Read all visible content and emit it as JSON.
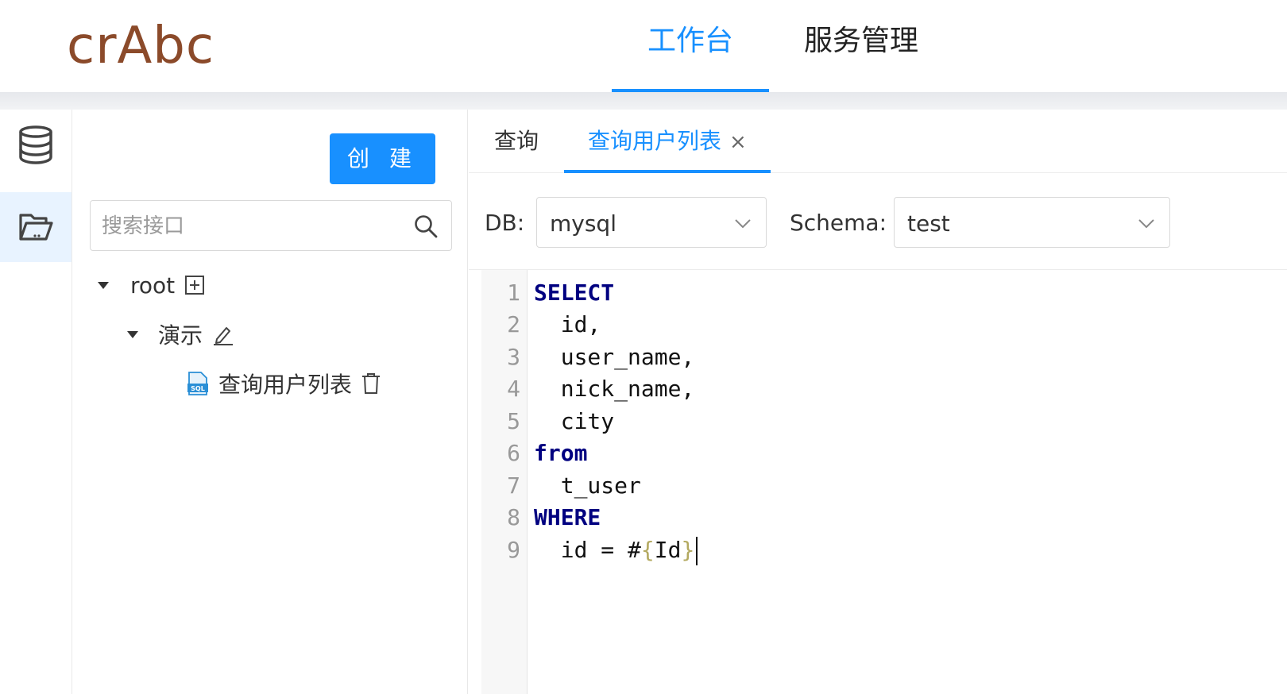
{
  "header": {
    "logo": "crAbc",
    "nav": [
      {
        "label": "工作台",
        "active": true
      },
      {
        "label": "服务管理",
        "active": false
      }
    ]
  },
  "rail": {
    "items": [
      {
        "icon": "database-icon",
        "active": false
      },
      {
        "icon": "folder-open-icon",
        "active": true
      }
    ]
  },
  "sidebar": {
    "create_label": "创 建",
    "search": {
      "placeholder": "搜索接口",
      "value": ""
    },
    "tree": {
      "root": {
        "label": "root",
        "expanded": true,
        "action_icon": "add-square-icon"
      },
      "group": {
        "label": "演示",
        "expanded": true,
        "action_icon": "edit-icon"
      },
      "leaf": {
        "label": "查询用户列表",
        "type_icon": "sql-file-icon",
        "action_icon": "delete-icon"
      }
    }
  },
  "editor_tabs": [
    {
      "label": "查询",
      "active": false,
      "closable": false
    },
    {
      "label": "查询用户列表",
      "active": true,
      "closable": true,
      "close_glyph": "×"
    }
  ],
  "toolbar": {
    "db_label": "DB:",
    "db_value": "mysql",
    "schema_label": "Schema:",
    "schema_value": "test"
  },
  "code": {
    "line_numbers": [
      "1",
      "2",
      "3",
      "4",
      "5",
      "6",
      "7",
      "8",
      "9"
    ],
    "lines": [
      "SELECT",
      "  id,",
      "  user_name,",
      "  nick_name,",
      "  city",
      "from",
      "  t_user",
      "WHERE",
      "  id = #{Id}"
    ],
    "line9_prefix": "  id = #",
    "line9_open": "{",
    "line9_var": "Id",
    "line9_close": "}"
  },
  "colors": {
    "accent": "#1890ff",
    "logo": "#8b4a2a",
    "keyword": "#000080",
    "brace": "#b3a960"
  }
}
